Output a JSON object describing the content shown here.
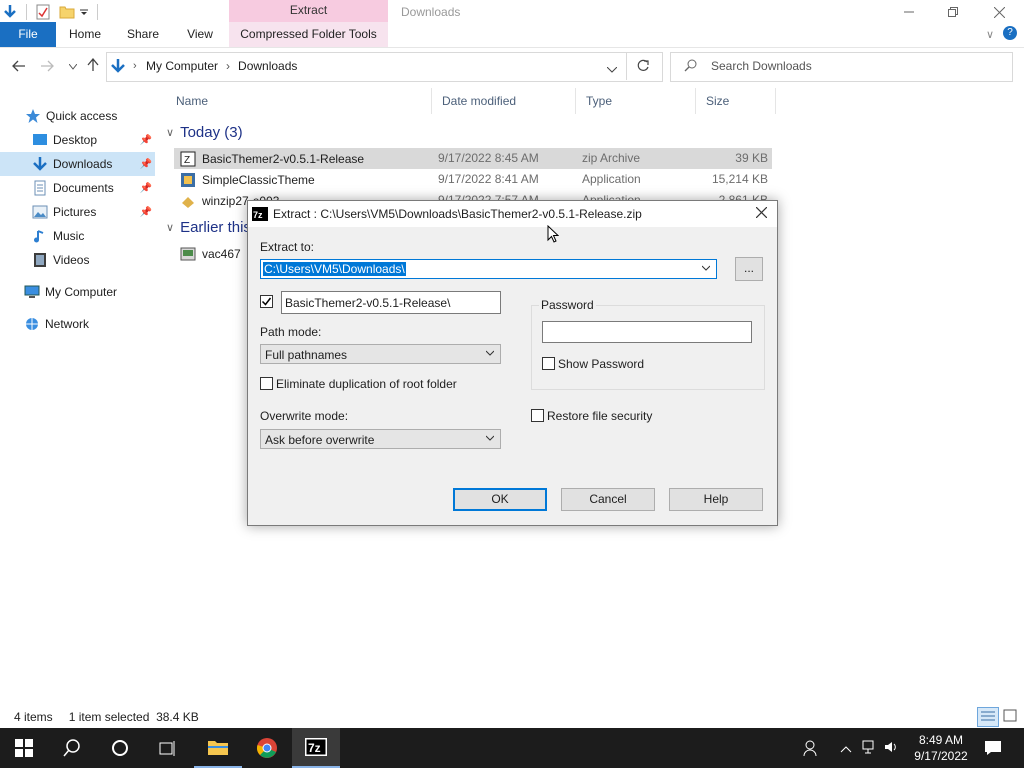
{
  "window": {
    "title": "Downloads",
    "context_tab_header": "Extract",
    "ribbon_tabs": [
      "File",
      "Home",
      "Share",
      "View",
      "Compressed Folder Tools"
    ]
  },
  "address": {
    "crumbs": [
      "My Computer",
      "Downloads"
    ],
    "search_placeholder": "Search Downloads"
  },
  "nav": {
    "items": [
      {
        "label": "Quick access",
        "icon": "star-icon",
        "pinned": false
      },
      {
        "label": "Desktop",
        "icon": "desktop-icon",
        "pinned": true
      },
      {
        "label": "Downloads",
        "icon": "download-arrow-icon",
        "pinned": true,
        "selected": true
      },
      {
        "label": "Documents",
        "icon": "documents-icon",
        "pinned": true
      },
      {
        "label": "Pictures",
        "icon": "pictures-icon",
        "pinned": true
      },
      {
        "label": "Music",
        "icon": "music-icon",
        "pinned": false
      },
      {
        "label": "Videos",
        "icon": "videos-icon",
        "pinned": false
      },
      {
        "label": "My Computer",
        "icon": "computer-icon",
        "pinned": false
      },
      {
        "label": "Network",
        "icon": "network-icon",
        "pinned": false
      }
    ]
  },
  "columns": [
    "Name",
    "Date modified",
    "Type",
    "Size"
  ],
  "groups": {
    "today": "Today (3)",
    "earlier": "Earlier this"
  },
  "files": [
    {
      "name": "BasicThemer2-v0.5.1-Release",
      "date": "9/17/2022 8:45 AM",
      "type": "zip Archive",
      "size": "39 KB"
    },
    {
      "name": "SimpleClassicTheme",
      "date": "9/17/2022 8:41 AM",
      "type": "Application",
      "size": "15,214 KB"
    },
    {
      "name": "winzip27-e003",
      "date": "9/17/2022 7:57 AM",
      "type": "Application",
      "size": "2,861 KB"
    },
    {
      "name": "vac467",
      "date": "",
      "type": "",
      "size": ""
    }
  ],
  "status": {
    "items": "4 items",
    "selected": "1 item selected",
    "size": "38.4 KB"
  },
  "dialog": {
    "title": "Extract : C:\\Users\\VM5\\Downloads\\BasicThemer2-v0.5.1-Release.zip",
    "extract_to_label": "Extract to:",
    "extract_to_value": "C:\\Users\\VM5\\Downloads\\",
    "browse_label": "...",
    "subfolder_value": "BasicThemer2-v0.5.1-Release\\",
    "path_mode_label": "Path mode:",
    "path_mode_value": "Full pathnames",
    "eliminate_label": "Eliminate duplication of root folder",
    "overwrite_label": "Overwrite mode:",
    "overwrite_value": "Ask before overwrite",
    "password_group": "Password",
    "show_password_label": "Show Password",
    "restore_security_label": "Restore file security",
    "ok": "OK",
    "cancel": "Cancel",
    "help": "Help",
    "subfolder_checked": true,
    "show_password_checked": false,
    "eliminate_checked": false,
    "restore_checked": false
  },
  "taskbar": {
    "time": "8:49 AM",
    "date": "9/17/2022"
  },
  "colors": {
    "file_tab": "#1a6fc2",
    "context_tab": "#f7cbe0",
    "selection": "#cce4f7",
    "accent": "#0078d7"
  }
}
